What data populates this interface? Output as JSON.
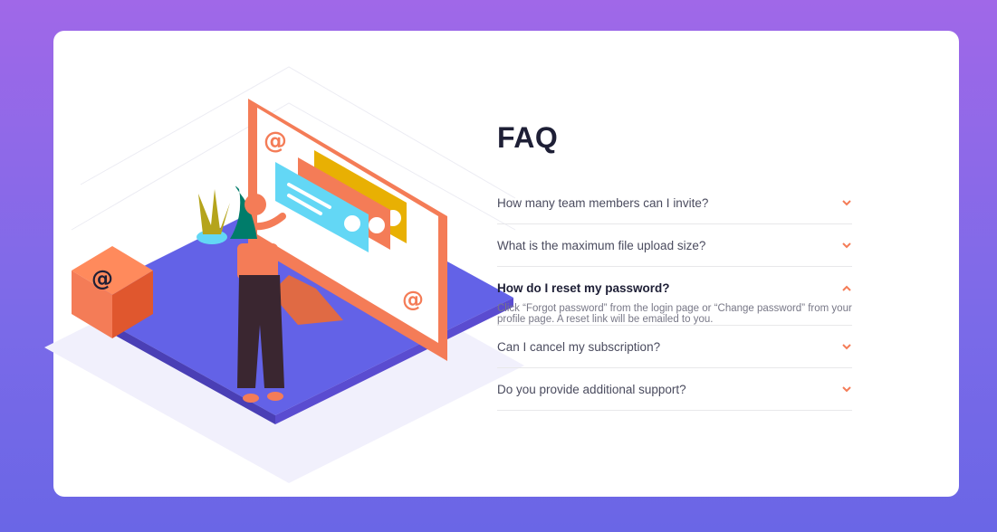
{
  "faq": {
    "title": "FAQ",
    "items": [
      {
        "question": "How many team members can I invite?",
        "open": false
      },
      {
        "question": "What is the maximum file upload size?",
        "open": false
      },
      {
        "question": "How do I reset my password?",
        "open": true,
        "answer": "Click “Forgot password” from the login page or “Change password” from your profile page. A reset link will be emailed to you."
      },
      {
        "question": "Can I cancel my subscription?",
        "open": false
      },
      {
        "question": "Do you provide additional support?",
        "open": false
      }
    ]
  },
  "colors": {
    "accent": "#f47c57",
    "background_top": "#a068e8",
    "background_bottom": "#6a66e6",
    "platform": "#6362e7"
  },
  "icons": {
    "collapsed": "chevron-down-icon",
    "expanded": "chevron-up-icon"
  }
}
